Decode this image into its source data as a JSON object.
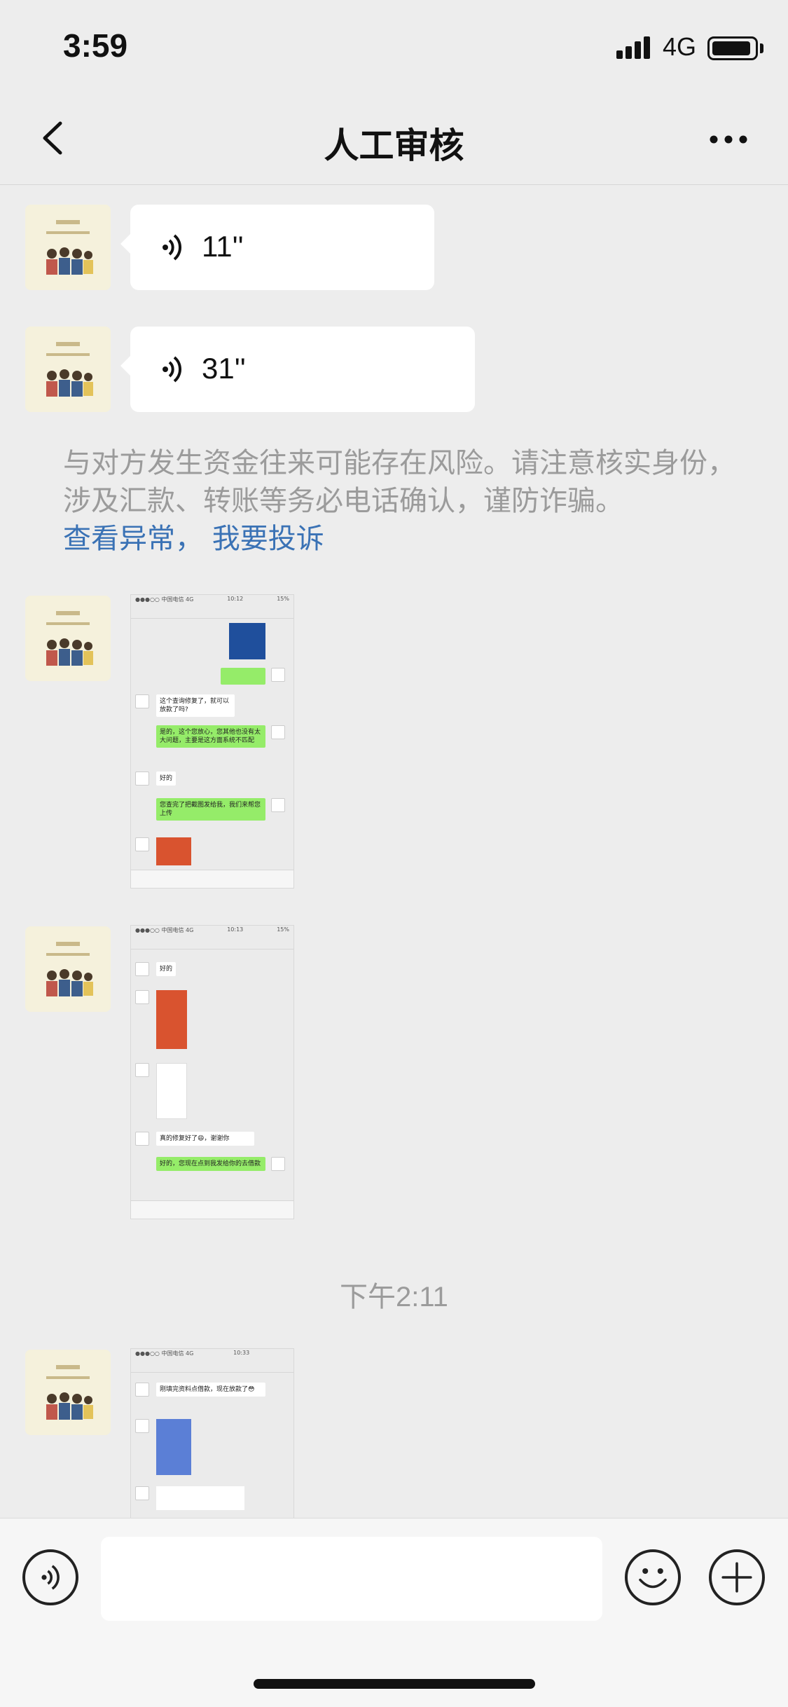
{
  "status_bar": {
    "time": "3:59",
    "network": "4G"
  },
  "nav": {
    "title": "人工审核",
    "back_icon": "chevron-left-icon",
    "more_icon": "ellipsis-icon"
  },
  "messages": {
    "voice_1": {
      "duration": "11''"
    },
    "voice_2": {
      "duration": "31''"
    },
    "warning": {
      "text": "与对方发生资金往来可能存在风险。请注意核实身份，涉及汇款、转账等务必电话确认，谨防诈骗。",
      "link_1": "查看异常",
      "separator": "，",
      "link_2": "我要投诉"
    },
    "image_1": {
      "status_left": "●●●○○ 中国电信  4G",
      "status_time": "10:12",
      "status_right": "15%",
      "lines": [
        "这个查询修复了，就可以放款了吗?",
        "是的，这个您放心，您其他也没有太大问题，主要是这方面系统不匹配",
        "好的",
        "您查完了把截图发给我，我们来帮您上传"
      ]
    },
    "image_2": {
      "status_left": "●●●○○ 中国电信  4G",
      "status_time": "10:13",
      "status_right": "15%",
      "lines": [
        "好的",
        "真的修复好了😄，谢谢你",
        "好的，您现在点到我发给你的去借款"
      ]
    },
    "time_separator": "下午2:11",
    "image_3": {
      "status_left": "●●●○○ 中国电信  4G",
      "status_time": "10:33",
      "status_right": "",
      "lines": [
        "刚填完资料点借款，现在放款了😳"
      ]
    }
  },
  "input_bar": {
    "placeholder": "",
    "voice_icon": "voice-icon",
    "emoji_icon": "emoji-icon",
    "plus_icon": "plus-icon"
  }
}
